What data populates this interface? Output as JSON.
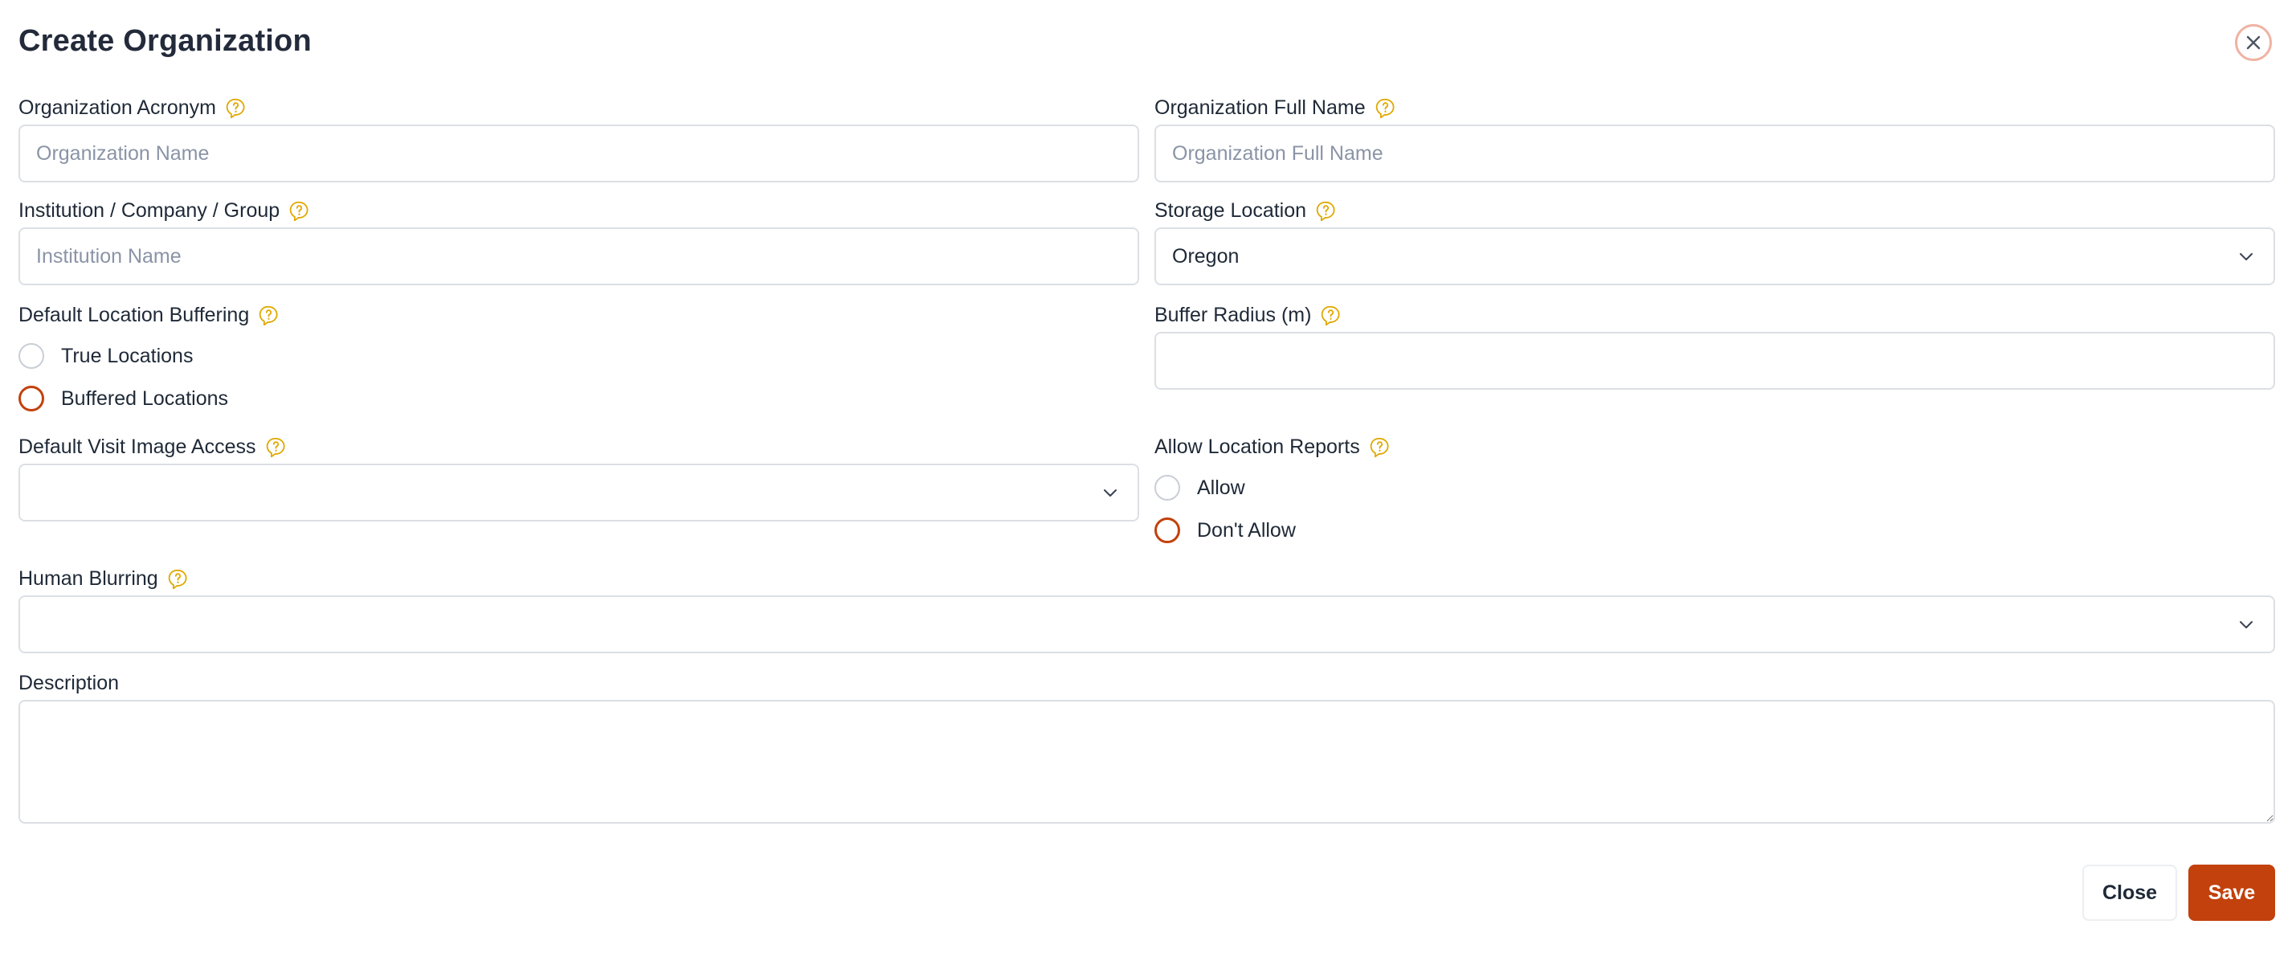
{
  "modal": {
    "title": "Create Organization"
  },
  "fields": {
    "acronym": {
      "label": "Organization Acronym",
      "placeholder": "Organization Name",
      "value": ""
    },
    "full_name": {
      "label": "Organization Full Name",
      "placeholder": "Organization Full Name",
      "value": ""
    },
    "institution": {
      "label": "Institution / Company / Group",
      "placeholder": "Institution Name",
      "value": ""
    },
    "storage_location": {
      "label": "Storage Location",
      "selected": "Oregon"
    },
    "location_buffering": {
      "label": "Default Location Buffering",
      "options": [
        "True Locations",
        "Buffered Locations"
      ],
      "selected": "Buffered Locations"
    },
    "buffer_radius": {
      "label": "Buffer Radius (m)",
      "value": ""
    },
    "visit_image_access": {
      "label": "Default Visit Image Access",
      "selected": ""
    },
    "location_reports": {
      "label": "Allow Location Reports",
      "options": [
        "Allow",
        "Don't Allow"
      ],
      "selected": "Don't Allow"
    },
    "human_blurring": {
      "label": "Human Blurring",
      "selected": ""
    },
    "description": {
      "label": "Description",
      "value": ""
    }
  },
  "footer": {
    "close_label": "Close",
    "save_label": "Save"
  },
  "icons": {
    "help": "help-bubble-icon",
    "close": "close-icon",
    "dropdown": "chevron-down-icon"
  },
  "colors": {
    "accent": "#c2410c",
    "help_icon": "#e0a800",
    "close_ring": "#f0b3a4"
  }
}
